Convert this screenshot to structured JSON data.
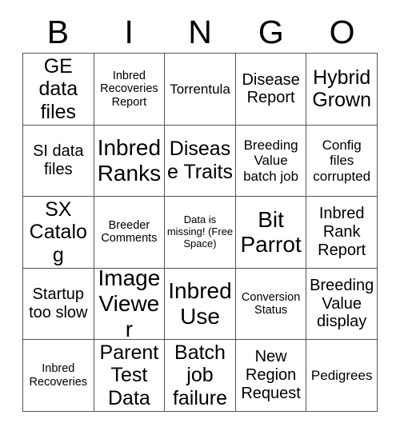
{
  "header": {
    "letters": [
      "B",
      "I",
      "N",
      "G",
      "O"
    ]
  },
  "card": {
    "columns": 5,
    "rows": 5,
    "border_color": "#555555",
    "background": "#ffffff",
    "text_color": "#000000",
    "free_space_index": 12,
    "cells": [
      {
        "text": "GE data files",
        "size": "xl"
      },
      {
        "text": "Inbred Recoveries Report",
        "size": "sm"
      },
      {
        "text": "Torrentula",
        "size": "md"
      },
      {
        "text": "Disease Report",
        "size": "lg"
      },
      {
        "text": "Hybrid Grown",
        "size": "xl"
      },
      {
        "text": "SI data files",
        "size": "lg"
      },
      {
        "text": "Inbred Ranks",
        "size": "xxl"
      },
      {
        "text": "Disease Traits",
        "size": "xl"
      },
      {
        "text": "Breeding Value batch job",
        "size": "md"
      },
      {
        "text": "Config files corrupted",
        "size": "md"
      },
      {
        "text": "SX Catalog",
        "size": "xl"
      },
      {
        "text": "Breeder Comments",
        "size": "sm"
      },
      {
        "text": "Data is missing! (Free Space)",
        "size": "xs"
      },
      {
        "text": "Bit Parrot",
        "size": "xxl"
      },
      {
        "text": "Inbred Rank Report",
        "size": "lg"
      },
      {
        "text": "Startup too slow",
        "size": "lg"
      },
      {
        "text": "Image Viewer",
        "size": "xxl"
      },
      {
        "text": "Inbred Use",
        "size": "xxl"
      },
      {
        "text": "Conversion Status",
        "size": "sm"
      },
      {
        "text": "Breeding Value display",
        "size": "lg"
      },
      {
        "text": "Inbred Recoveries",
        "size": "sm"
      },
      {
        "text": "Parent Test Data",
        "size": "xl"
      },
      {
        "text": "Batch job failure",
        "size": "xl"
      },
      {
        "text": "New Region Request",
        "size": "lg"
      },
      {
        "text": "Pedigrees",
        "size": "md"
      }
    ]
  }
}
